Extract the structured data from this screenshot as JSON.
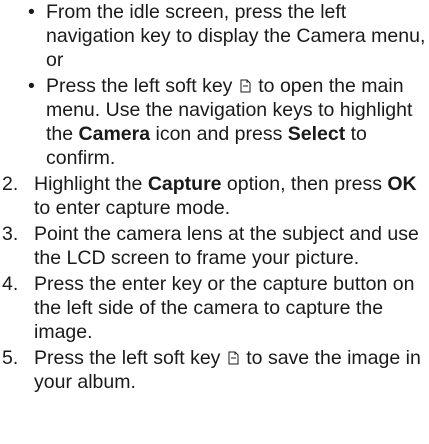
{
  "bullets": [
    {
      "marker": "•",
      "text": "From the idle screen, press the left navigation key to display the Camera menu, or"
    },
    {
      "marker": "•",
      "p1": "Press the left soft key",
      "softkey_icon": "soft-key-icon",
      "p2": "to open the main menu. Use the navigation keys to highlight the ",
      "b1": "Camera",
      "p3": " icon and press ",
      "b2": "Select",
      "p4": " to confirm."
    }
  ],
  "steps": [
    {
      "num": "2.",
      "p1": "Highlight the ",
      "b1": "Capture",
      "p2": " option, then press ",
      "b2": "OK",
      "p3": " to enter capture mode."
    },
    {
      "num": "3.",
      "text": "Point the camera lens at the subject and use the LCD screen to frame your picture."
    },
    {
      "num": "4.",
      "text": "Press the enter key or the capture button on the left side of the camera to capture the image."
    },
    {
      "num": "5.",
      "p1": "Press the left soft key",
      "softkey_icon": "soft-key-icon",
      "p2": "to save the image in your album."
    }
  ]
}
